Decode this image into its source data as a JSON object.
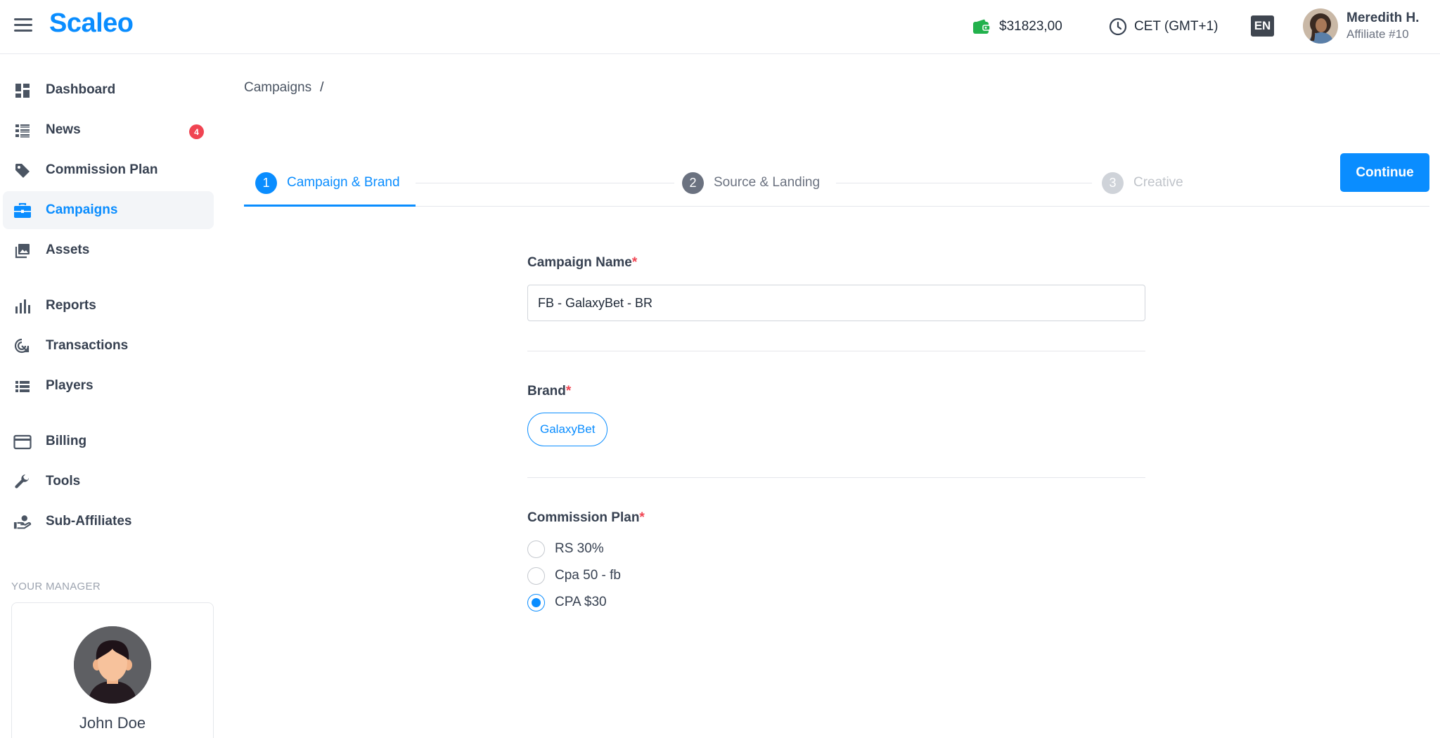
{
  "app": {
    "logo": "Scaleo"
  },
  "header": {
    "balance": "$31823,00",
    "timezone": "CET (GMT+1)",
    "language": "EN",
    "user": {
      "name": "Meredith H.",
      "subtitle": "Affiliate #10"
    }
  },
  "sidebar": {
    "items": [
      {
        "label": "Dashboard",
        "icon": "dashboard-icon"
      },
      {
        "label": "News",
        "icon": "news-icon",
        "badge": "4"
      },
      {
        "label": "Commission Plan",
        "icon": "tag-icon"
      },
      {
        "label": "Campaigns",
        "icon": "briefcase-icon",
        "active": true
      },
      {
        "label": "Assets",
        "icon": "images-icon"
      },
      {
        "label": "Reports",
        "icon": "bar-chart-icon"
      },
      {
        "label": "Transactions",
        "icon": "transactions-icon"
      },
      {
        "label": "Players",
        "icon": "list-icon"
      },
      {
        "label": "Billing",
        "icon": "credit-card-icon"
      },
      {
        "label": "Tools",
        "icon": "wrench-icon"
      },
      {
        "label": "Sub-Affiliates",
        "icon": "sub-affiliates-icon"
      }
    ],
    "manager": {
      "title": "YOUR MANAGER",
      "name": "John Doe"
    }
  },
  "breadcrumb": {
    "items": [
      "Campaigns"
    ],
    "separator": "/"
  },
  "stepper": {
    "steps": [
      {
        "number": "1",
        "label": "Campaign & Brand",
        "state": "active"
      },
      {
        "number": "2",
        "label": "Source & Landing",
        "state": "upcoming"
      },
      {
        "number": "3",
        "label": "Creative",
        "state": "disabled"
      }
    ],
    "continue_label": "Continue"
  },
  "form": {
    "campaign_name": {
      "label": "Campaign Name",
      "required": "*",
      "value": "FB - GalaxyBet - BR"
    },
    "brand": {
      "label": "Brand",
      "required": "*",
      "selected": "GalaxyBet"
    },
    "commission_plan": {
      "label": "Commission Plan",
      "required": "*",
      "options": [
        {
          "label": "RS 30%",
          "checked": false
        },
        {
          "label": "Cpa 50 - fb",
          "checked": false
        },
        {
          "label": "CPA $30",
          "checked": true
        }
      ]
    }
  },
  "colors": {
    "accent": "#0a8dff",
    "badge": "#f04452",
    "wallet": "#22b14c"
  }
}
